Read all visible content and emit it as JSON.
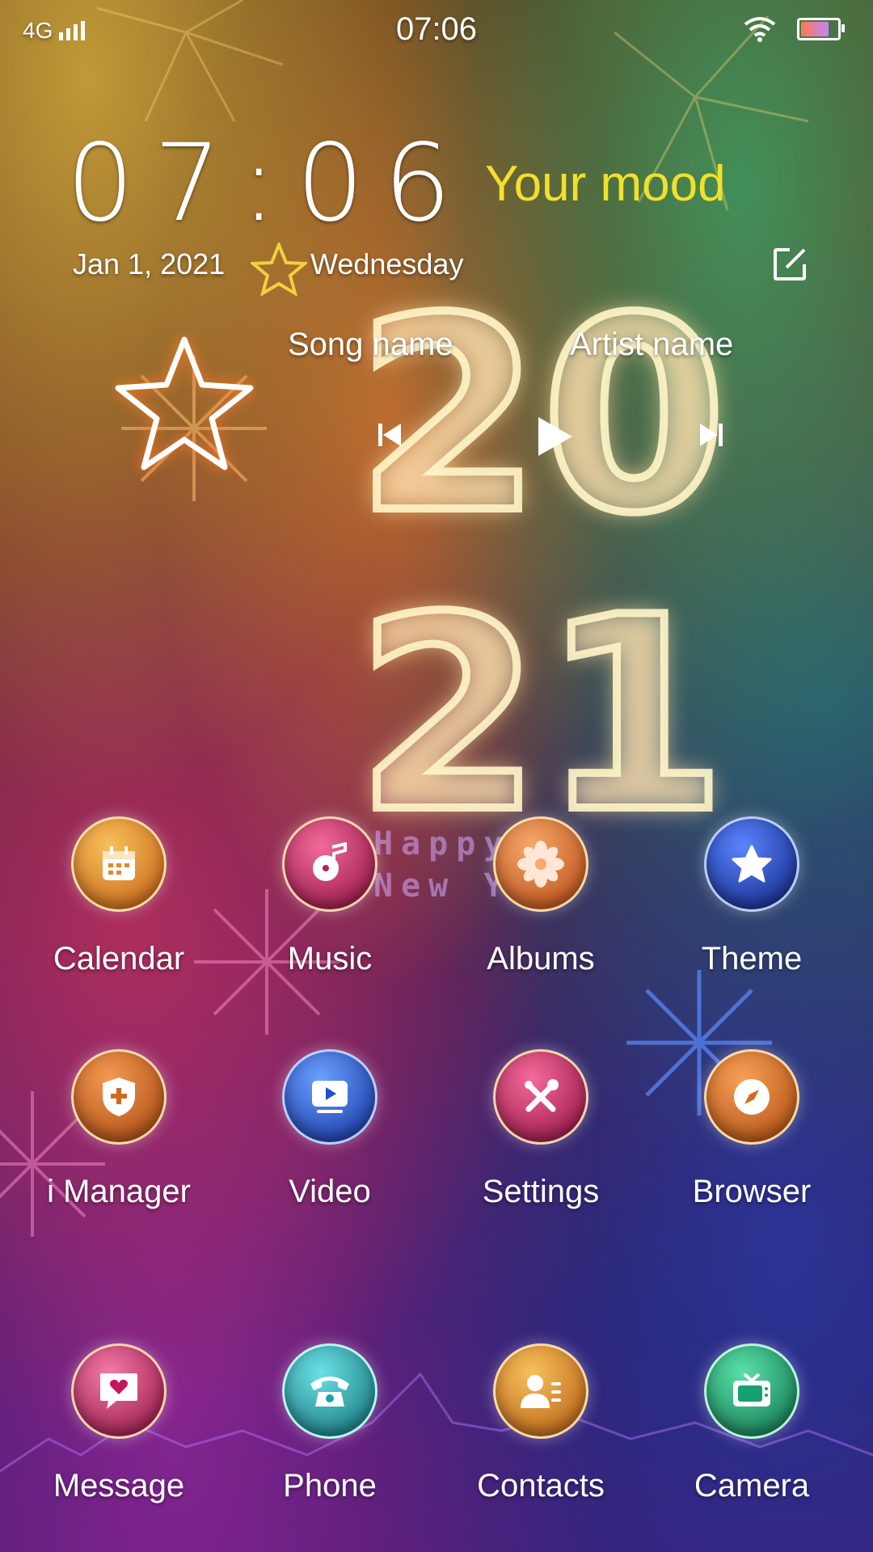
{
  "status_bar": {
    "network": "4G",
    "time": "07:06",
    "battery_level": 0.85
  },
  "clock_widget": {
    "time": "07:06",
    "date": "Jan 1, 2021",
    "weekday": "Wednesday",
    "mood": "Your mood"
  },
  "music_widget": {
    "song": "Song name",
    "artist": "Artist name"
  },
  "wallpaper": {
    "year_top": "20",
    "year_bottom": "21",
    "greeting_line1": "Happy",
    "greeting_line2": "New Ye"
  },
  "apps": [
    {
      "label": "Calendar",
      "icon": "calendar-icon",
      "color": "#e08a2a"
    },
    {
      "label": "Music",
      "icon": "music-icon",
      "color": "#c2185b"
    },
    {
      "label": "Albums",
      "icon": "flower-icon",
      "color": "#e0762a"
    },
    {
      "label": "Theme",
      "icon": "star-icon",
      "color": "#1a3fb5"
    },
    {
      "label": "i Manager",
      "icon": "shield-icon",
      "color": "#d26a1e"
    },
    {
      "label": "Video",
      "icon": "video-icon",
      "color": "#1e4fcf"
    },
    {
      "label": "Settings",
      "icon": "tools-icon",
      "color": "#c2185b"
    },
    {
      "label": "Browser",
      "icon": "compass-icon",
      "color": "#d9661e"
    },
    {
      "label": "Message",
      "icon": "message-heart-icon",
      "color": "#c2185b"
    },
    {
      "label": "Phone",
      "icon": "phone-icon",
      "color": "#1aa3a8"
    },
    {
      "label": "Contacts",
      "icon": "contacts-icon",
      "color": "#d9821e"
    },
    {
      "label": "Camera",
      "icon": "tv-icon",
      "color": "#19a070"
    }
  ]
}
